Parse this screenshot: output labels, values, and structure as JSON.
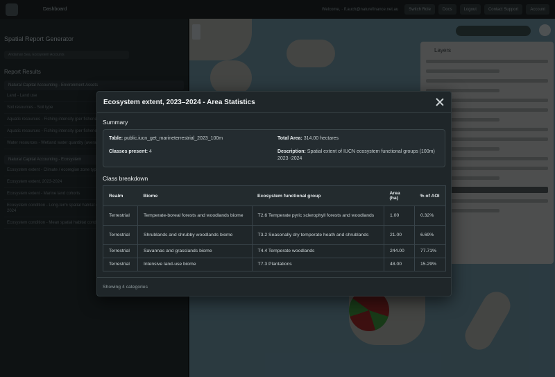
{
  "topbar": {
    "nav": "Dashboard",
    "welcome": "Welcome, · lf.auch@naturefinance.net.au",
    "buttons": [
      "Switch Role",
      "Docs",
      "Logout",
      "Contact Support",
      "Account"
    ]
  },
  "sidebar": {
    "title": "Spatial Report Generator",
    "chip": "Andaman Sea, Ecosystem Accounts",
    "section": "Report Results",
    "group1": "Natural Capital Accounting - Environment Assets",
    "items1": [
      "Land - Land use",
      "Soil resources - Soil type",
      "Aquatic resources - Fishing intensity (per fisheries jurisdiction) - 2024",
      "Aquatic resources - Fishing intensity (per fisheries jurisdiction) - 2024",
      "Water resources - Wetland water quantity (average)"
    ],
    "group2": "Natural Capital Accounting - Ecosystem",
    "items2": [
      "Ecosystem extent - Climate / ecoregion zone types",
      "Ecosystem extent, 2023-2024",
      "Ecosystem extent - Marine land cohorts",
      "Ecosystem condition - Long-term spatial habitat condition index (2024) - classifications, 1990-2024",
      "Ecosystem condition - Mean spatial habitat condition index, 2024-2024"
    ]
  },
  "layers": {
    "title": "Layers"
  },
  "modal": {
    "title": "Ecosystem extent, 2023–2024 - Area Statistics",
    "summary_title": "Summary",
    "summary": {
      "table_label": "Table:",
      "table_value": "public.iucn_get_marineterrestrial_2023_100m",
      "total_label": "Total Area:",
      "total_value": "314.00 hectares",
      "classes_label": "Classes present:",
      "classes_value": "4",
      "desc_label": "Description:",
      "desc_value": "Spatial extent of IUCN ecosystem functional groups (100m) 2023 -2024"
    },
    "breakdown_title": "Class breakdown",
    "columns": [
      "Realm",
      "Biome",
      "Ecosystem functional group",
      "Area (ha)",
      "% of AOI"
    ],
    "rows": [
      {
        "realm": "Terrestrial",
        "biome": "Temperate-boreal forests and woodlands biome",
        "efg": "T2.6 Temperate pyric sclerophyll forests and woodlands",
        "area": "1.00",
        "aoi": "0.32%"
      },
      {
        "realm": "Terrestrial",
        "biome": "Shrublands and shrubby woodlands biome",
        "efg": "T3.2 Seasonally dry temperate heath and shrublands",
        "area": "21.00",
        "aoi": "6.69%"
      },
      {
        "realm": "Terrestrial",
        "biome": "Savannas and grasslands biome",
        "efg": "T4.4 Temperate woodlands",
        "area": "244.00",
        "aoi": "77.71%"
      },
      {
        "realm": "Terrestrial",
        "biome": "Intensive land-use biome",
        "efg": "T7.3 Plantations",
        "area": "48.00",
        "aoi": "15.29%"
      }
    ],
    "footer": "Showing 4 categories"
  }
}
